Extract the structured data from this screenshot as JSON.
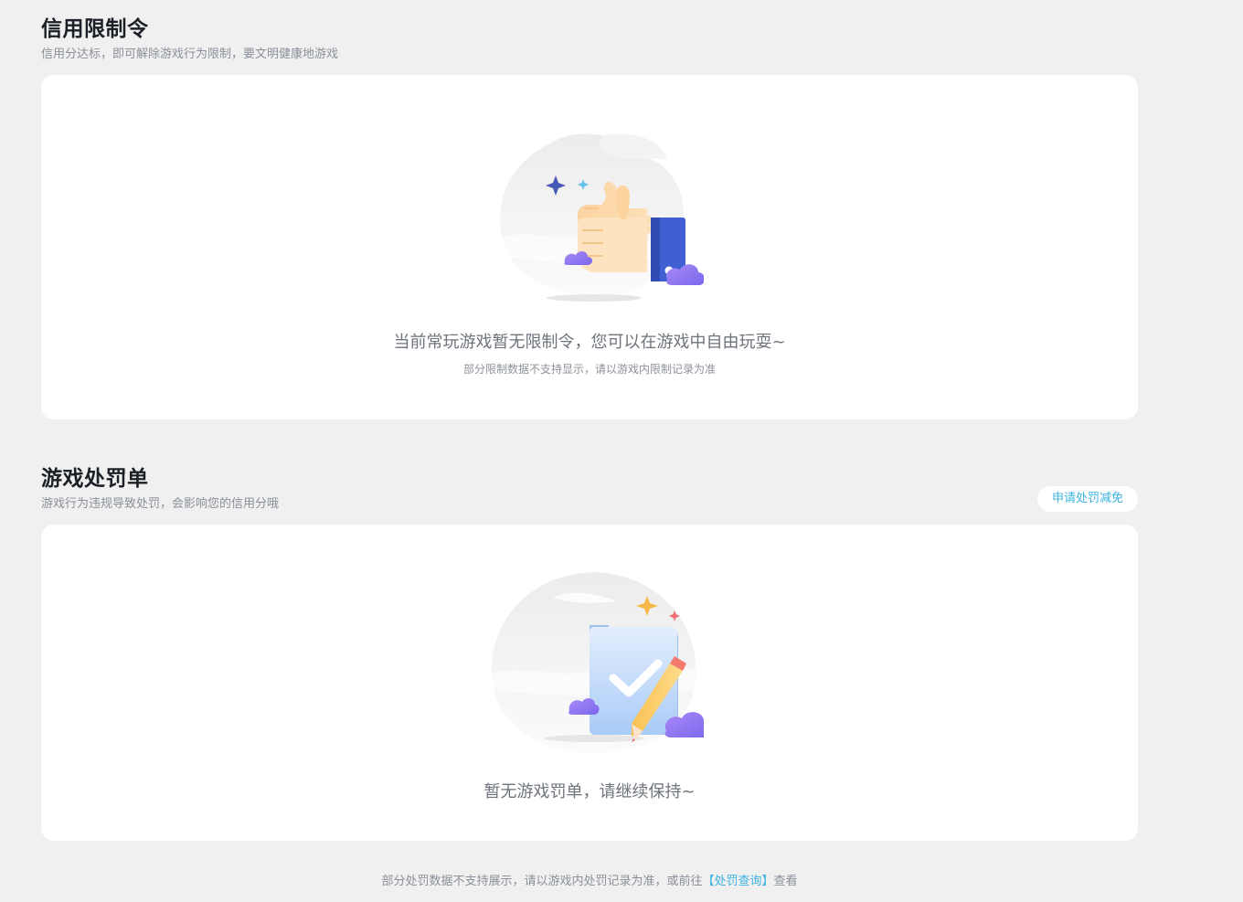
{
  "restriction": {
    "title": "信用限制令",
    "subtitle": "信用分达标，即可解除游戏行为限制，要文明健康地游戏",
    "empty_main": "当前常玩游戏暂无限制令，您可以在游戏中自由玩耍~",
    "empty_sub": "部分限制数据不支持显示，请以游戏内限制记录为准",
    "illustration_icon": "thumbs-up-icon"
  },
  "penalty": {
    "title": "游戏处罚单",
    "subtitle": "游戏行为违规导致处罚，会影响您的信用分哦",
    "apply_button": "申请处罚减免",
    "empty_main": "暂无游戏罚单，请继续保持~",
    "illustration_icon": "checked-folder-pencil-icon"
  },
  "footer": {
    "text_before": "部分处罚数据不支持展示，请以游戏内处罚记录为准，或前往",
    "link": "【处罚查询】",
    "text_after": "查看"
  },
  "colors": {
    "page_background": "#f0f0f0",
    "card_background": "#ffffff",
    "accent_link": "#3bb3e0",
    "title_text": "#1b1f26",
    "subtitle_text": "#8a8f99"
  }
}
